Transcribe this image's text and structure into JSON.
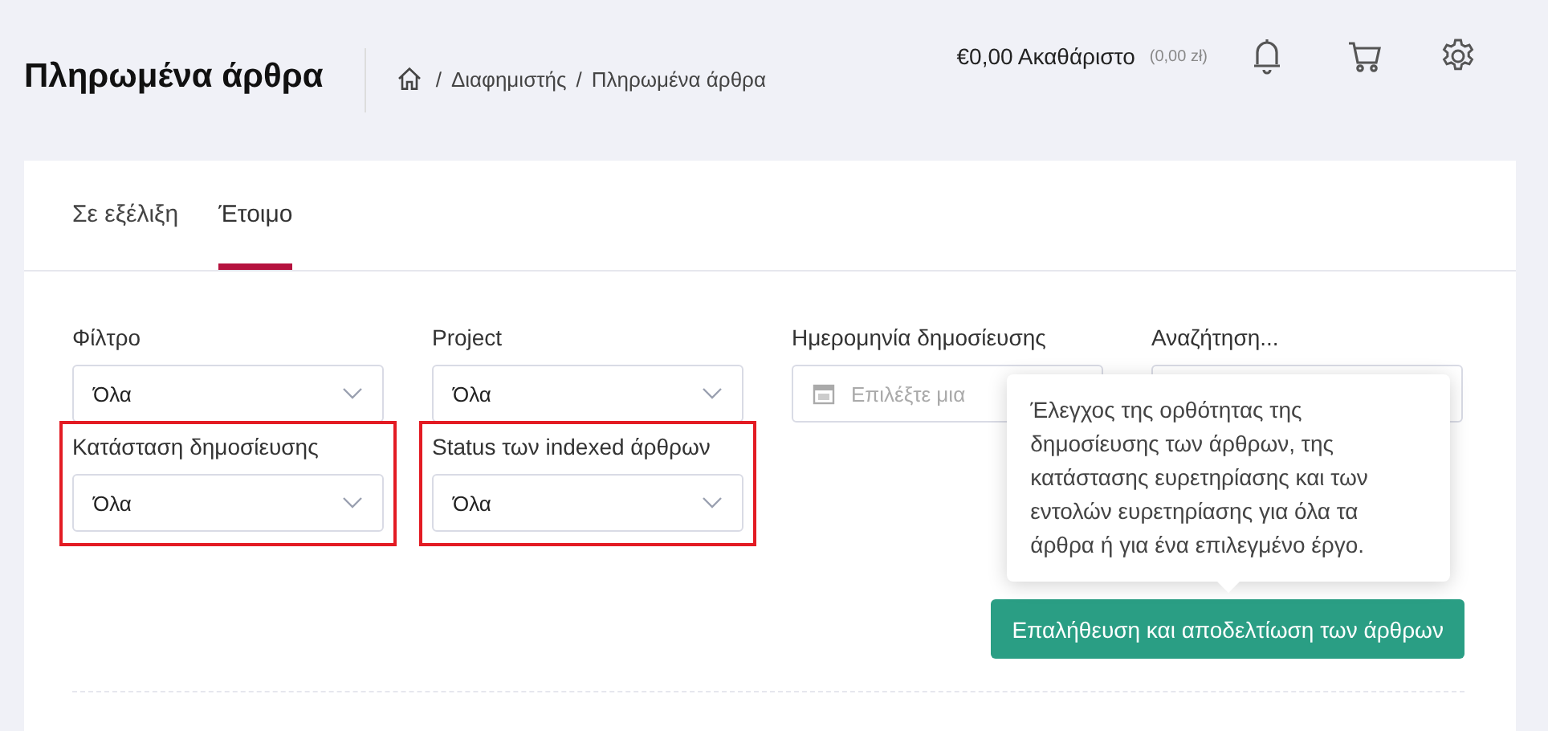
{
  "header": {
    "title": "Πληρωμένα άρθρα",
    "breadcrumb": [
      "Διαφημιστής",
      "Πληρωμένα άρθρα"
    ],
    "separator": "/",
    "balance": "€0,00 Ακαθάριστο",
    "balance_local": "(0,00 zł)"
  },
  "tabs": [
    {
      "label": "Σε εξέλιξη",
      "selected": false
    },
    {
      "label": "Έτοιμο",
      "selected": true
    }
  ],
  "filters": [
    {
      "kind": "select",
      "label": "Φίλτρο",
      "value": "Όλα",
      "highlighted": false
    },
    {
      "kind": "select",
      "label": "Project",
      "value": "Όλα",
      "highlighted": false
    },
    {
      "kind": "date",
      "label": "Ημερομηνία δημοσίευσης",
      "placeholder": "Επιλέξτε μια",
      "highlighted": false
    },
    {
      "kind": "search",
      "label": "Αναζήτηση...",
      "highlighted": false
    },
    {
      "kind": "select",
      "label": "Κατάσταση δημοσίευσης",
      "value": "Όλα",
      "highlighted": true
    },
    {
      "kind": "select",
      "label": "Status των indexed άρθρων",
      "value": "Όλα",
      "highlighted": true
    }
  ],
  "tooltip": "Έλεγχος της ορθότητας της δημοσίευσης των άρθρων, της κατάστασης ευρετηρίασης και των εντολών ευρετηρίασης για όλα τα άρθρα ή για ένα επιλεγμένο έργο.",
  "action_button": "Επαλήθευση και αποδελτίωση των άρθρων"
}
